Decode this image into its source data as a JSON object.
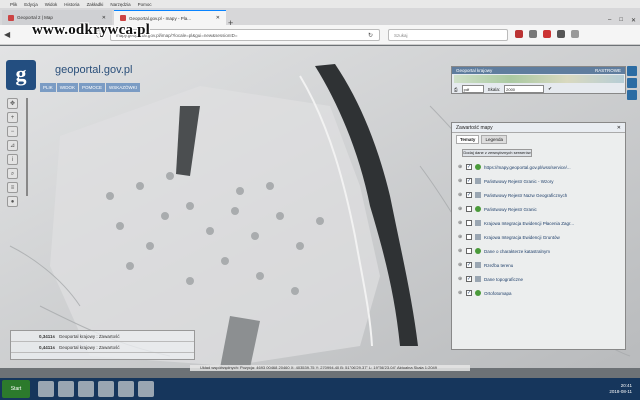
{
  "browser": {
    "menu": [
      "Plik",
      "Edycja",
      "Widok",
      "Historia",
      "Zakładki",
      "Narzędzia",
      "Pomoc"
    ],
    "tabs": [
      {
        "label": "Geoportal 2 | Map"
      },
      {
        "label": "Geoportal.gov.pl - mapy - Pla..."
      }
    ],
    "url": "mapy.geoportal.gov.pl/imap/?locale=pl&gui=new&sessionID=",
    "search_placeholder": "Szukaj"
  },
  "watermark": "www.odkrywca.pl",
  "site": {
    "logo_letter": "g",
    "brand": "geoportal.gov.pl",
    "nav": [
      "PLIK",
      "WIDOK",
      "POMOCE",
      "WSKAZÓWKI"
    ]
  },
  "overview_panel": {
    "title": "Geoportal krajowy",
    "badge": "RASTROWE",
    "format": "pdf",
    "scale_label": "Skala:",
    "scale_value": "2000"
  },
  "layers_panel": {
    "title": "Zawartość mapy",
    "tabs": [
      "Tematy",
      "Legenda"
    ],
    "add_button": "Dodaj dane z zewnętrznych serwerów",
    "layers": [
      {
        "label": "https://mapy.geoportal.gov.pl/wss/service/...",
        "checked": true
      },
      {
        "label": "Państwowy Rejestr Granic - Wzory",
        "checked": true
      },
      {
        "label": "Państwowy Rejestr Nazw Geograficznych",
        "checked": true
      },
      {
        "label": "Państwowy Rejestr Granic",
        "checked": false
      },
      {
        "label": "Krajowa Integracja Ewidencji Płacenia Zagr...",
        "checked": false
      },
      {
        "label": "Krajowa Integracja Ewidencji Gruntów",
        "checked": false
      },
      {
        "label": "Dane o charakterze katastralnym",
        "checked": false
      },
      {
        "label": "Rzeźba terenu",
        "checked": true
      },
      {
        "label": "Dane topograficzne",
        "checked": true
      },
      {
        "label": "Ortofotomapa",
        "checked": true
      }
    ]
  },
  "scale_info": {
    "rows": [
      {
        "value": "0,3411s",
        "text": "Geoportal krajowy : Zawartość"
      },
      {
        "value": "0,4411s",
        "text": "Geoportal krajowy : Zawartość"
      }
    ]
  },
  "status_line": "Układ współrzędnych: Pozycja: 4693 00468 20460   X: 403539.75  Y: 270994.40   B: 51°06'29.37\"  L: 19°56'23.04\"   Aktualna Skala 1:2049",
  "taskbar": {
    "start": "Start",
    "time": "20:41",
    "date": "2018-08-11"
  }
}
